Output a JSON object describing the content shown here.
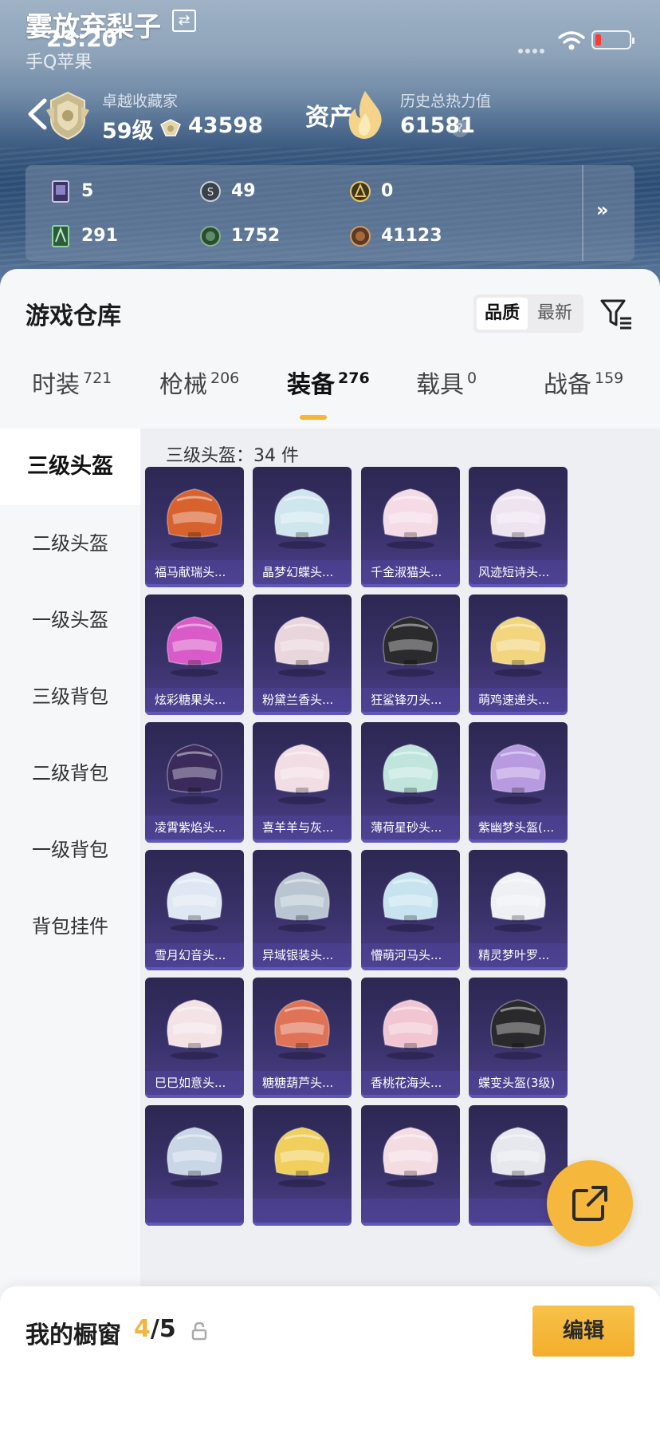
{
  "status_bar": {
    "time": "23:20"
  },
  "profile": {
    "nickname": "霎放弃梨子",
    "platform": "手Q苹果",
    "platform_extra": "",
    "rank_title": "卓越收藏家",
    "rank_level": "59级",
    "medal_count": "43598",
    "asset_label": "资产",
    "heat_title": "历史总热力值",
    "heat_value": "61581",
    "help_symbol": "?"
  },
  "currencies": [
    {
      "icon": "card-icon",
      "value": "5"
    },
    {
      "icon": "silver-coin-icon",
      "value": "49"
    },
    {
      "icon": "gold-coin-icon",
      "value": "0"
    },
    {
      "icon": "green-card-icon",
      "value": "291"
    },
    {
      "icon": "green-coin-icon",
      "value": "1752"
    },
    {
      "icon": "bronze-coin-icon",
      "value": "41123"
    }
  ],
  "warehouse": {
    "title": "游戏仓库",
    "sort_options": [
      "品质",
      "最新"
    ],
    "tabs": [
      {
        "label": "时装",
        "count": "721"
      },
      {
        "label": "枪械",
        "count": "206"
      },
      {
        "label": "装备",
        "count": "276",
        "active": true
      },
      {
        "label": "载具",
        "count": "0"
      },
      {
        "label": "战备",
        "count": "159"
      }
    ]
  },
  "sidebar": {
    "items": [
      {
        "label": "三级头盔",
        "active": true
      },
      {
        "label": "二级头盔"
      },
      {
        "label": "一级头盔"
      },
      {
        "label": "三级背包"
      },
      {
        "label": "二级背包"
      },
      {
        "label": "一级背包"
      },
      {
        "label": "背包挂件"
      }
    ]
  },
  "grid": {
    "title": "三级头盔：34 件",
    "items": [
      {
        "name": "福马献瑞头...",
        "color": "#d8622e"
      },
      {
        "name": "晶梦幻蝶头...",
        "color": "#cfe6ee"
      },
      {
        "name": "千金淑猫头...",
        "color": "#f4dbe5"
      },
      {
        "name": "风迹短诗头...",
        "color": "#eee4f0"
      },
      {
        "name": "炫彩糖果头...",
        "color": "#d85bc9"
      },
      {
        "name": "粉黛兰香头...",
        "color": "#e9d5dc"
      },
      {
        "name": "狂鲨锋刃头...",
        "color": "#2b2b2e"
      },
      {
        "name": "萌鸡速递头...",
        "color": "#f2d57c"
      },
      {
        "name": "凌霄紫焰头...",
        "color": "#3a2b5c"
      },
      {
        "name": "喜羊羊与灰...",
        "color": "#f2dde4"
      },
      {
        "name": "薄荷星砂头...",
        "color": "#bfe5dd"
      },
      {
        "name": "紫幽梦头盔(...",
        "color": "#b79ae0"
      },
      {
        "name": "雪月幻音头...",
        "color": "#dfe7f2"
      },
      {
        "name": "异域银装头...",
        "color": "#b9c6d1"
      },
      {
        "name": "懵萌河马头...",
        "color": "#c7e3ef"
      },
      {
        "name": "精灵梦叶罗...",
        "color": "#eef0f4"
      },
      {
        "name": "巳巳如意头...",
        "color": "#f3e2e6"
      },
      {
        "name": "糖糖葫芦头...",
        "color": "#e07256"
      },
      {
        "name": "香桃花海头...",
        "color": "#f1c6d2"
      },
      {
        "name": "蝶变头盔(3级)",
        "color": "#2a2a2c"
      },
      {
        "name": "",
        "color": "#c9d6e6"
      },
      {
        "name": "",
        "color": "#f0cf5c"
      },
      {
        "name": "",
        "color": "#f4dce3"
      },
      {
        "name": "",
        "color": "#e7e8ee"
      }
    ]
  },
  "showcase": {
    "title": "我的橱窗",
    "current": "4",
    "separator": "/",
    "max": "5",
    "edit_label": "编辑"
  }
}
